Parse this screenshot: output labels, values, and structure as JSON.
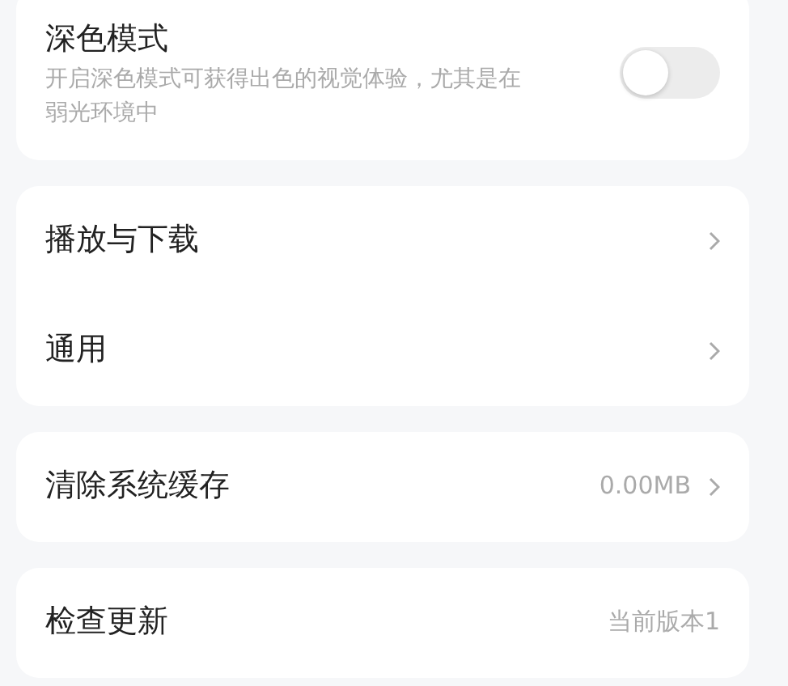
{
  "sections": [
    {
      "items": [
        {
          "kind": "toggle",
          "label": "深色模式",
          "description": "开启深色模式可获得出色的视觉体验，尤其是在弱光环境中",
          "on": false
        }
      ]
    },
    {
      "items": [
        {
          "kind": "link",
          "label": "播放与下载"
        },
        {
          "kind": "link",
          "label": "通用"
        }
      ]
    },
    {
      "items": [
        {
          "kind": "link",
          "label": "清除系统缓存",
          "value": "0.00MB"
        }
      ]
    },
    {
      "items": [
        {
          "kind": "info",
          "label": "检查更新",
          "value": "当前版本1"
        }
      ]
    }
  ]
}
